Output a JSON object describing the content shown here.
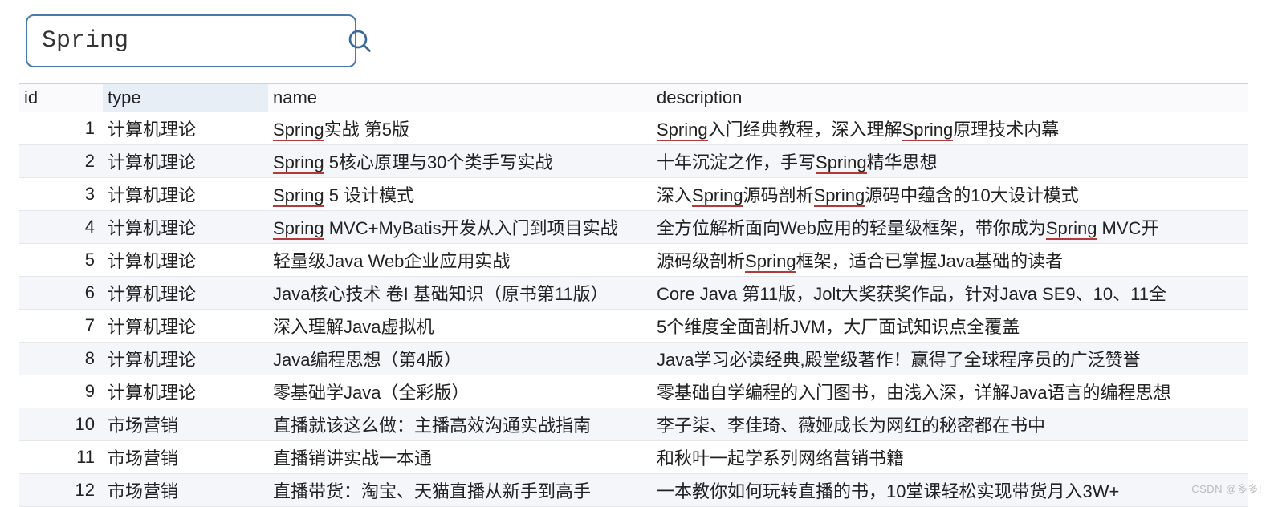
{
  "search": {
    "value": "Spring",
    "highlight": "Spring"
  },
  "columns": {
    "id": "id",
    "type": "type",
    "name": "name",
    "description": "description"
  },
  "rows": [
    {
      "id": "1",
      "type": "计算机理论",
      "name": "Spring实战 第5版",
      "description": "Spring入门经典教程，深入理解Spring原理技术内幕"
    },
    {
      "id": "2",
      "type": "计算机理论",
      "name": "Spring 5核心原理与30个类手写实战",
      "description": "十年沉淀之作，手写Spring精华思想"
    },
    {
      "id": "3",
      "type": "计算机理论",
      "name": "Spring 5 设计模式",
      "description": "深入Spring源码剖析Spring源码中蕴含的10大设计模式"
    },
    {
      "id": "4",
      "type": "计算机理论",
      "name": "Spring MVC+MyBatis开发从入门到项目实战",
      "description": "全方位解析面向Web应用的轻量级框架，带你成为Spring MVC开"
    },
    {
      "id": "5",
      "type": "计算机理论",
      "name": "轻量级Java Web企业应用实战",
      "description": "源码级剖析Spring框架，适合已掌握Java基础的读者"
    },
    {
      "id": "6",
      "type": "计算机理论",
      "name": "Java核心技术 卷I 基础知识（原书第11版）",
      "description": "Core Java 第11版，Jolt大奖获奖作品，针对Java SE9、10、11全"
    },
    {
      "id": "7",
      "type": "计算机理论",
      "name": "深入理解Java虚拟机",
      "description": "5个维度全面剖析JVM，大厂面试知识点全覆盖"
    },
    {
      "id": "8",
      "type": "计算机理论",
      "name": "Java编程思想（第4版）",
      "description": "Java学习必读经典,殿堂级著作！赢得了全球程序员的广泛赞誉"
    },
    {
      "id": "9",
      "type": "计算机理论",
      "name": "零基础学Java（全彩版）",
      "description": "零基础自学编程的入门图书，由浅入深，详解Java语言的编程思想"
    },
    {
      "id": "10",
      "type": "市场营销",
      "name": "直播就该这么做：主播高效沟通实战指南",
      "description": "李子柒、李佳琦、薇娅成长为网红的秘密都在书中"
    },
    {
      "id": "11",
      "type": "市场营销",
      "name": "直播销讲实战一本通",
      "description": "和秋叶一起学系列网络营销书籍"
    },
    {
      "id": "12",
      "type": "市场营销",
      "name": "直播带货：淘宝、天猫直播从新手到高手",
      "description": "一本教你如何玩转直播的书，10堂课轻松实现带货月入3W+"
    }
  ],
  "watermark": "CSDN @多多!"
}
